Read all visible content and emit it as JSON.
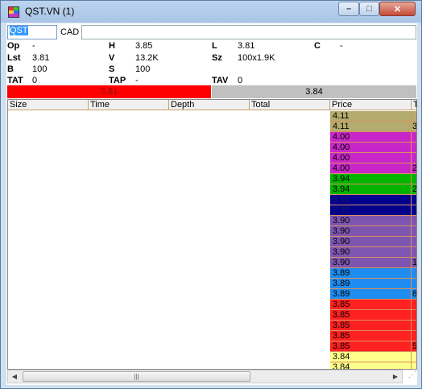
{
  "window": {
    "title": "QST.VN (1)",
    "minimize": "–",
    "maximize": "□",
    "close": "✕"
  },
  "toolbar": {
    "symbol": "QST",
    "currency": "CAD",
    "name": ""
  },
  "quote": {
    "op_label": "Op",
    "op_value": "-",
    "h_label": "H",
    "h_value": "3.85",
    "l_label": "L",
    "l_value": "3.81",
    "c_label": "C",
    "c_value": "-",
    "lst_label": "Lst",
    "lst_value": "3.81",
    "v_label": "V",
    "v_value": "13.2K",
    "sz_label": "Sz",
    "sz_value": "100x1.9K",
    "b_label": "B",
    "b_value": "100",
    "s_label": "S",
    "s_value": "100",
    "tat_label": "TAT",
    "tat_value": "0",
    "tap_label": "TAP",
    "tap_value": "-",
    "tav_label": "TAV",
    "tav_value": "0"
  },
  "bidask": {
    "bid": "3.81",
    "ask": "3.84",
    "bid_color": "#ff0000",
    "ask_color": "#c0c0c0"
  },
  "table": {
    "columns": [
      "Size",
      "Time",
      "Depth",
      "Total",
      "Price",
      "T"
    ],
    "rows": [
      {
        "price": "4.11",
        "t": "",
        "color": "#b4ac6e",
        "text": "#000"
      },
      {
        "price": "4.11",
        "t": "3",
        "color": "#b4ac6e",
        "text": "#000"
      },
      {
        "price": "4.00",
        "t": "",
        "color": "#c826c8",
        "text": "#000"
      },
      {
        "price": "4.00",
        "t": "",
        "color": "#c826c8",
        "text": "#000"
      },
      {
        "price": "4.00",
        "t": "",
        "color": "#c826c8",
        "text": "#000"
      },
      {
        "price": "4.00",
        "t": "2",
        "color": "#c826c8",
        "text": "#000"
      },
      {
        "price": "3.94",
        "t": "",
        "color": "#00b400",
        "text": "#000"
      },
      {
        "price": "3.94",
        "t": "2",
        "color": "#00b400",
        "text": "#000"
      },
      {
        "price": "3.92",
        "t": "",
        "color": "#00008c",
        "text": "#1a1a60"
      },
      {
        "price": "3.92",
        "t": "",
        "color": "#00008c",
        "text": "#1a1a60"
      },
      {
        "price": "3.90",
        "t": "",
        "color": "#7e55b0",
        "text": "#000"
      },
      {
        "price": "3.90",
        "t": "",
        "color": "#7e55b0",
        "text": "#000"
      },
      {
        "price": "3.90",
        "t": "",
        "color": "#7e55b0",
        "text": "#000"
      },
      {
        "price": "3.90",
        "t": "",
        "color": "#7e55b0",
        "text": "#000"
      },
      {
        "price": "3.90",
        "t": "1",
        "color": "#7e55b0",
        "text": "#000"
      },
      {
        "price": "3.89",
        "t": "",
        "color": "#1e8cf0",
        "text": "#000"
      },
      {
        "price": "3.89",
        "t": "",
        "color": "#1e8cf0",
        "text": "#000"
      },
      {
        "price": "3.89",
        "t": "8",
        "color": "#1e8cf0",
        "text": "#000"
      },
      {
        "price": "3.85",
        "t": "",
        "color": "#ff2020",
        "text": "#000"
      },
      {
        "price": "3.85",
        "t": "",
        "color": "#ff2020",
        "text": "#000"
      },
      {
        "price": "3.85",
        "t": "",
        "color": "#ff2020",
        "text": "#000"
      },
      {
        "price": "3.85",
        "t": "",
        "color": "#ff2020",
        "text": "#000"
      },
      {
        "price": "3.85",
        "t": "5",
        "color": "#ff2020",
        "text": "#000"
      },
      {
        "price": "3.84",
        "t": "",
        "color": "#ffff8c",
        "text": "#000"
      },
      {
        "price": "3.84",
        "t": "",
        "color": "#ffff8c",
        "text": "#000"
      }
    ]
  },
  "scroll": {
    "left": "◀",
    "right": "▶",
    "grip": "|||",
    "size_grip": "⋰"
  }
}
